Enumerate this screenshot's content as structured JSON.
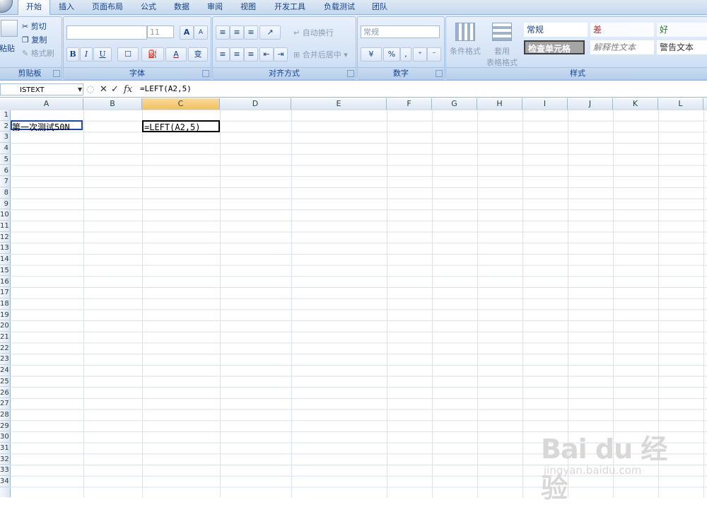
{
  "tabs": [
    "开始",
    "插入",
    "页面布局",
    "公式",
    "数据",
    "审阅",
    "视图",
    "开发工具",
    "负载测试",
    "团队"
  ],
  "ribbon": {
    "clipboard": {
      "paste": "粘贴",
      "cut": "剪切",
      "copy": "复制",
      "format_painter": "格式刷",
      "label": "剪贴板"
    },
    "font": {
      "font_size": "11",
      "label": "字体",
      "bold": "B",
      "italic": "I",
      "underline": "U",
      "font_color": "A",
      "grow": "A",
      "shrink": "A",
      "phonetic": "变"
    },
    "alignment": {
      "wrap_text": "自动换行",
      "merge_center": "合并后居中",
      "label": "对齐方式"
    },
    "number": {
      "format": "常规",
      "percent": "%",
      "comma": ",",
      "label": "数字"
    },
    "styles": {
      "conditional_format": "条件格式",
      "table_format_line1": "套用",
      "table_format_line2": "表格格式",
      "cells": [
        "常规",
        "差",
        "好",
        "检查单元格",
        "解释性文本",
        "警告文本"
      ],
      "label": "样式"
    }
  },
  "formula_bar": {
    "name_box": "ISTEXT",
    "formula": "=LEFT(A2,5)",
    "fx": "fx"
  },
  "columns": [
    "A",
    "B",
    "C",
    "D",
    "E",
    "F",
    "G",
    "H",
    "I",
    "J",
    "K",
    "L"
  ],
  "rows": [
    "1",
    "2",
    "3",
    "4",
    "5",
    "6",
    "7",
    "8",
    "9",
    "10",
    "11",
    "12",
    "13",
    "14",
    "15",
    "16",
    "17",
    "18",
    "19",
    "20",
    "21",
    "22",
    "23",
    "24",
    "25",
    "26",
    "27",
    "28",
    "29",
    "30",
    "31",
    "32",
    "33",
    "34"
  ],
  "cells": {
    "A2": "第一次测试50N",
    "C2": "=LEFT(A2,5)"
  },
  "watermark": {
    "logo": "Bai du 经验",
    "url": "jingyan.baidu.com"
  }
}
